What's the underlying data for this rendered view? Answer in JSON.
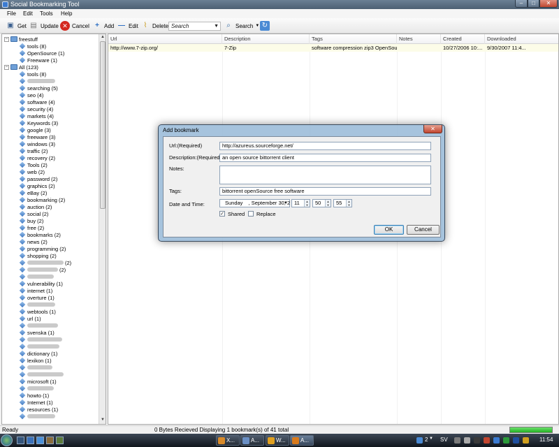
{
  "window": {
    "title": "Social Bookmarking Tool"
  },
  "menu": [
    "File",
    "Edit",
    "Tools",
    "Help"
  ],
  "toolbar": {
    "get": "Get",
    "update": "Update",
    "cancel": "Cancel",
    "add": "Add",
    "edit": "Edit",
    "delete": "Delete",
    "search_placeholder": "Search",
    "search": "Search"
  },
  "tree": {
    "freestuff": {
      "label": "freestuff",
      "children": [
        "tools (8)",
        "OpenSource (1)",
        "Freeware (1)"
      ]
    },
    "all": {
      "label": "All (123)",
      "children": [
        "tools (8)",
        "",
        "searching (5)",
        "seo (4)",
        "software (4)",
        "security (4)",
        "markets (4)",
        "Keywords (3)",
        "google (3)",
        "freeware (3)",
        "windows (3)",
        "traffic (2)",
        "recovery (2)",
        "Tools (2)",
        "web (2)",
        "password (2)",
        "graphics (2)",
        "eBay (2)",
        "bookmarking (2)",
        "auction (2)",
        "social (2)",
        "buy (2)",
        "free (2)",
        "bookmarks (2)",
        "news (2)",
        "programming (2)",
        "shopping (2)",
        "(2)",
        "(2)",
        "",
        "vulnerability (1)",
        "internet (1)",
        "overture (1)",
        "",
        "webtools (1)",
        "url (1)",
        "",
        "svenska (1)",
        "",
        "",
        "dictionary (1)",
        "lexikon (1)",
        "",
        "",
        "microsoft (1)",
        "",
        "howto (1)",
        "Internet (1)",
        "resources (1)",
        ""
      ]
    }
  },
  "grid": {
    "columns": [
      "Url",
      "Description",
      "Tags",
      "Notes",
      "Created",
      "Downloaded"
    ],
    "rows": [
      {
        "url": "http://www.7-zip.org/",
        "description": "7-Zip",
        "tags": "software compression zip3 OpenSour...",
        "notes": "",
        "created": "10/27/2006 10:...",
        "downloaded": "9/30/2007 11:4..."
      }
    ]
  },
  "status": {
    "ready": "Ready",
    "message": "0 Bytes Recieved   Displaying 1 bookmark(s) of 41 total",
    "progress": 1.0
  },
  "dialog": {
    "title": "Add bookmark",
    "url_label": "Url:(Required)",
    "url_value": "http://azureus.sourceforge.net/",
    "desc_label": "Description:(Required)",
    "desc_value": "an open source  bittorrent client",
    "notes_label": "Notes:",
    "notes_value": "",
    "tags_label": "Tags:",
    "tags_value": "bittorrent openSource free software",
    "datetime_label": "Date and Time:",
    "day": "Sunday",
    "date": ", September 30, 2",
    "hour": "11",
    "minute": "50",
    "second": "55",
    "shared_label": "Shared",
    "shared_checked": true,
    "replace_label": "Replace",
    "replace_checked": false,
    "ok": "OK",
    "cancel": "Cancel"
  },
  "taskbar": {
    "tasks": [
      "X...",
      "A...",
      "W...",
      "A..."
    ],
    "language": "SV",
    "clock": "11:54",
    "notif_count": "2"
  }
}
